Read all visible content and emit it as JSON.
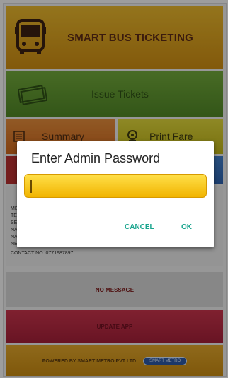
{
  "header": {
    "title": "SMART BUS TICKETING",
    "icon": "bus-icon"
  },
  "tiles": {
    "issue": {
      "label": "Issue Tickets",
      "icon": "tickets-icon"
    },
    "summary": {
      "label": "Summary",
      "icon": "summary-icon"
    },
    "print_fare": {
      "label": "Print Fare",
      "icon": "print-fare-icon"
    }
  },
  "info": {
    "lines": [
      "ME",
      "TE",
      "SE",
      "NA",
      "NA",
      "NE"
    ],
    "contact": "CONTACT NO: 0771987897"
  },
  "no_message": "NO MESSAGE",
  "update_app": "UPDATE APP",
  "footer": {
    "powered": "POWERED BY SMART METRO PVT LTD",
    "badge": "SMART METRO"
  },
  "dialog": {
    "title": "Enter Admin Password",
    "password_value": "",
    "cancel": "CANCEL",
    "ok": "OK"
  },
  "colors": {
    "accent": "#1aa58e",
    "field": "#f1b400"
  }
}
